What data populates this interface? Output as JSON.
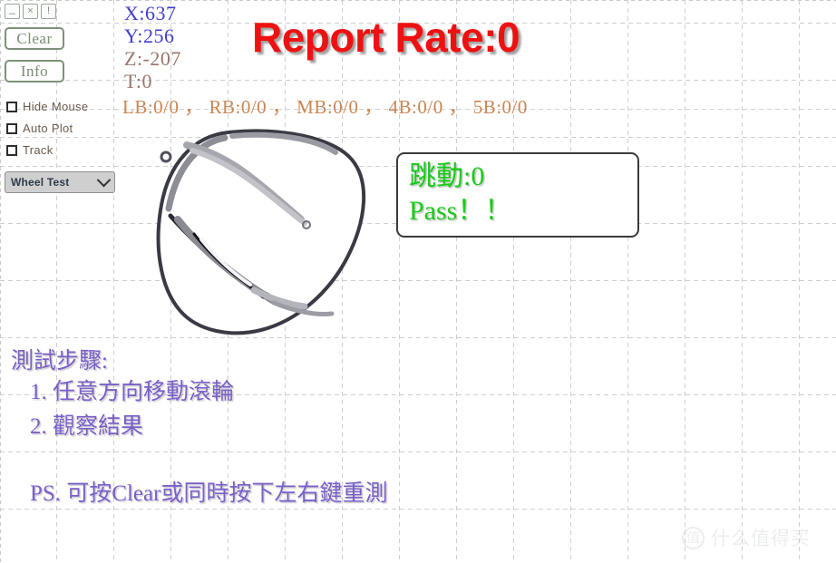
{
  "window_controls": [
    {
      "name": "minimize",
      "glyph": "_"
    },
    {
      "name": "close",
      "glyph": "×"
    },
    {
      "name": "alert",
      "glyph": "!"
    }
  ],
  "toolbar": {
    "clear_label": "Clear",
    "info_label": "Info"
  },
  "checkboxes": [
    {
      "label": "Hide Mouse",
      "checked": false
    },
    {
      "label": "Auto Plot",
      "checked": false
    },
    {
      "label": "Track",
      "checked": false
    }
  ],
  "mode_select": {
    "selected": "Wheel Test",
    "options": [
      "Wheel Test"
    ],
    "icon": "chevron-down-icon"
  },
  "readout": {
    "x": "X:637",
    "y": "Y:256",
    "z": "Z:-207",
    "t": "T:0",
    "buttons": "LB:0/0 ， RB:0/0 ， MB:0/0 ， 4B:0/0 ， 5B:0/0",
    "x_color": "#3f3fd0",
    "y_color": "#3f3fd0",
    "z_color": "#99756b",
    "t_color": "#99756b",
    "buttons_color": "#c98654"
  },
  "report_rate": {
    "text": "Report Rate:0",
    "color": "#ee1111"
  },
  "result": {
    "line1": "跳動:0",
    "line2": "Pass！！",
    "color": "#17cc17"
  },
  "instructions": {
    "title": "測試步驟:",
    "step1": "1. 任意方向移動滾輪",
    "step2": "2. 觀察結果",
    "ps": "PS. 可按Clear或同時按下左右鍵重測",
    "color": "#7a5fc9"
  },
  "watermark": {
    "badge": "值",
    "text": "什么值得买"
  },
  "canvas": {
    "grid_color": "#c9c9c9",
    "grid_spacing": 63,
    "background": "#ffffff"
  }
}
